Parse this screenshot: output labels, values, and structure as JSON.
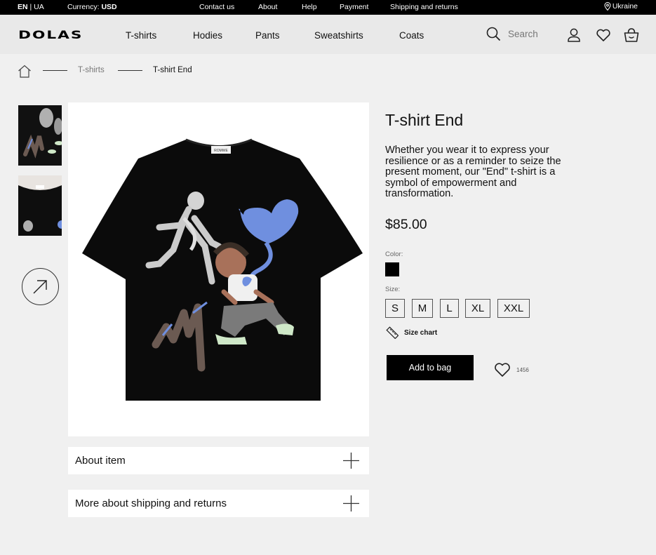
{
  "topbar": {
    "lang_active": "EN",
    "lang_sep": "|",
    "lang_other": "UA",
    "currency_label": "Currency:",
    "currency_value": "USD",
    "links": [
      "Contact us",
      "About",
      "Help",
      "Payment",
      "Shipping and returns"
    ],
    "region": "Ukraine"
  },
  "header": {
    "logo": "DOLAS",
    "nav": [
      "T-shirts",
      "Hodies",
      "Pants",
      "Sweatshirts",
      "Coats"
    ],
    "search_placeholder": "Search"
  },
  "breadcrumb": {
    "category": "T-shirts",
    "current": "T-shirt End"
  },
  "product": {
    "title": "T-shirt End",
    "description": "Whether you wear it to express your resilience or as a reminder to seize the present moment, our \"End\" t-shirt is a symbol of empowerment and transformation.",
    "price": "$85.00",
    "color_label": "Color:",
    "color_value": "#000000",
    "size_label": "Size:",
    "sizes": [
      "S",
      "M",
      "L",
      "XL",
      "XXL"
    ],
    "size_chart": "Size chart",
    "add_to_bag": "Add to bag",
    "likes": "1456",
    "tag_text": "ROMWE"
  },
  "accordions": [
    "About item",
    "More about shipping and returns"
  ],
  "colors": {
    "accent": "#000000",
    "background": "#f0f0f0",
    "header": "#e9e9e9",
    "balloon": "#6f8fdf"
  }
}
